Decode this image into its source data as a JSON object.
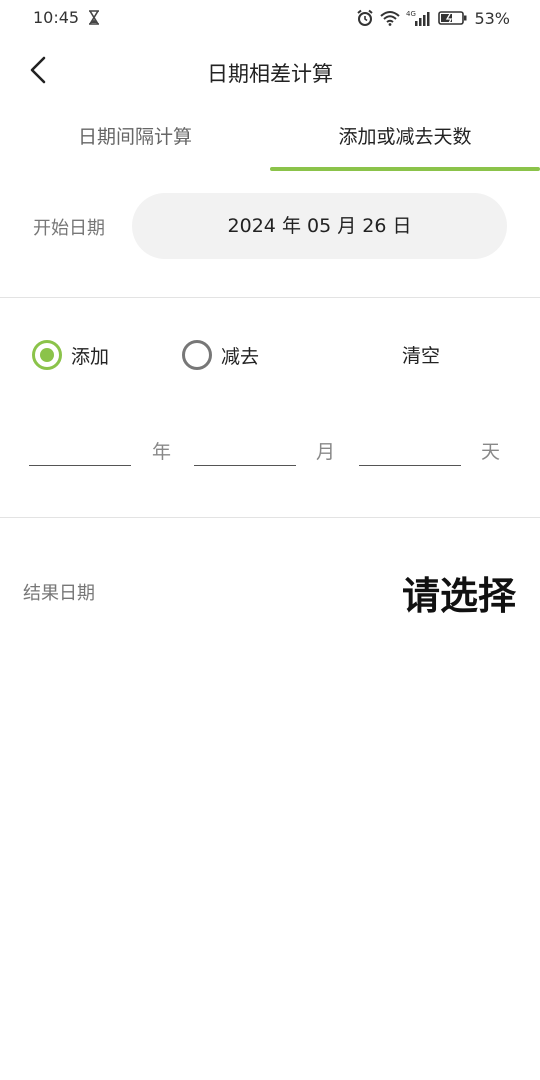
{
  "status_bar": {
    "time": "10:45",
    "battery_percent": "53%",
    "network": "4G"
  },
  "header": {
    "title": "日期相差计算"
  },
  "tabs": [
    {
      "label": "日期间隔计算",
      "selected": false
    },
    {
      "label": "添加或减去天数",
      "selected": true
    }
  ],
  "start_date": {
    "label": "开始日期",
    "value": "2024 年 05 月 26 日"
  },
  "operation": {
    "options": [
      {
        "label": "添加",
        "selected": true
      },
      {
        "label": "减去",
        "selected": false
      }
    ],
    "clear_label": "清空"
  },
  "offset_inputs": {
    "year": {
      "value": "",
      "unit": "年"
    },
    "month": {
      "value": "",
      "unit": "月"
    },
    "day": {
      "value": "",
      "unit": "天"
    }
  },
  "result": {
    "label": "结果日期",
    "value": "请选择"
  },
  "colors": {
    "accent": "#8bc34a",
    "pill_background": "#f2f2f2",
    "divider": "#e3e3e3"
  }
}
